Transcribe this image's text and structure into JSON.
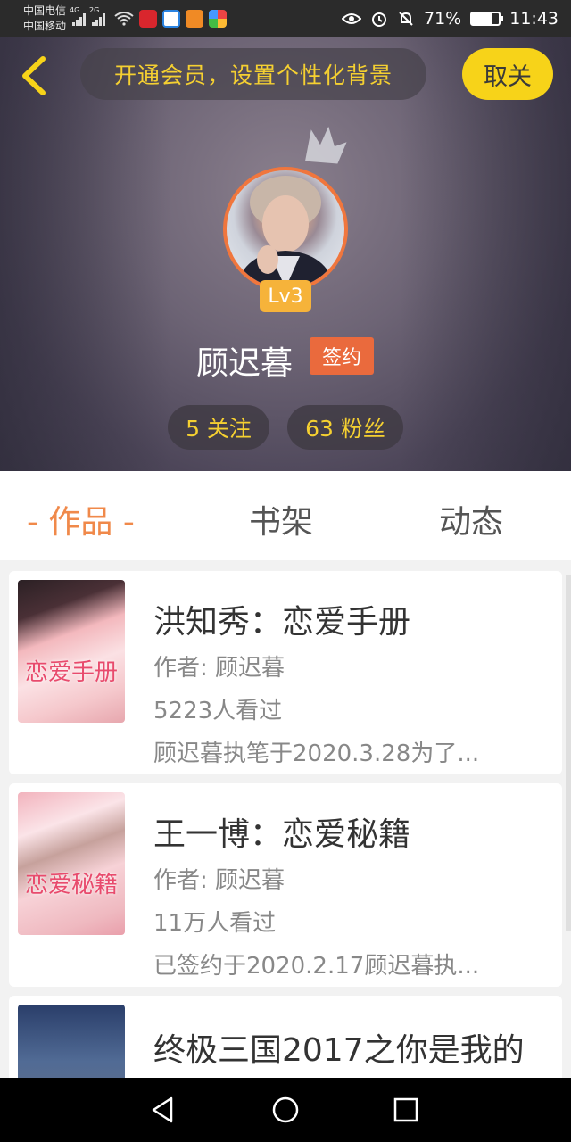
{
  "status_bar": {
    "carrier1": "中国电信",
    "carrier2": "中国移动",
    "net1": "4G",
    "net2": "2G",
    "battery": "71%",
    "battery_level": 0.71,
    "time": "11:43"
  },
  "header": {
    "promo_text": "开通会员，设置个性化背景",
    "close_label": "取关",
    "level": "Lv3",
    "username": "顾迟暮",
    "sign_tag": "签约",
    "following": "5 关注",
    "followers": "63 粉丝"
  },
  "tabs": [
    {
      "label": "- 作品 -",
      "active": true
    },
    {
      "label": "书架",
      "active": false
    },
    {
      "label": "动态",
      "active": false
    }
  ],
  "books": [
    {
      "cover_text": "恋爱手册",
      "title": "洪知秀：恋爱手册",
      "author": "作者: 顾迟暮",
      "views": "5223人看过",
      "desc": "顾迟暮执笔于2020.3.28为了..."
    },
    {
      "cover_text": "恋爱秘籍",
      "title": "王一博：恋爱秘籍",
      "author": "作者: 顾迟暮",
      "views": "11万人看过",
      "desc": "已签约于2020.2.17顾迟暮执..."
    },
    {
      "cover_text": "",
      "title": "终极三国2017之你是我的"
    }
  ],
  "colors": {
    "accent": "#f0894a",
    "yellow": "#f7d319",
    "sign": "#ea6a3d"
  }
}
